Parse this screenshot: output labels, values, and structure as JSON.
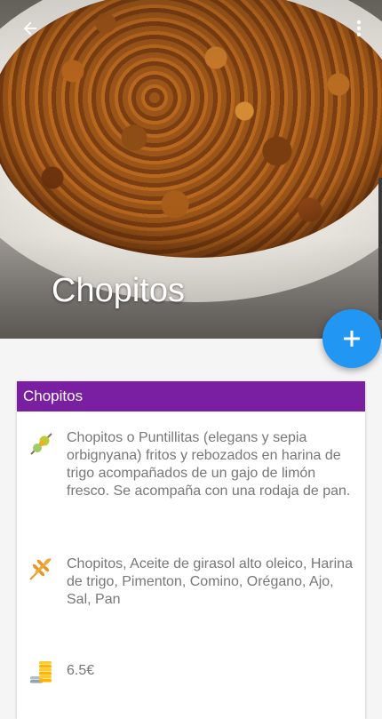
{
  "hero": {
    "title": "Chopitos"
  },
  "toolbar": {
    "back_icon": "arrow-back-icon",
    "menu_icon": "more-vert-icon"
  },
  "fab": {
    "icon": "plus-icon",
    "color": "#2196f3"
  },
  "card": {
    "header_color": "#7b1fa2",
    "title": "Chopitos",
    "description": {
      "icon": "skewer-icon",
      "text": "Chopitos o Puntillitas (elegans y sepia orbignyana) fritos y rebozados en harina de trigo acompañados de un gajo de limón fresco. Se acompaña con una rodaja de pan."
    },
    "ingredients": {
      "icon": "wheat-icon",
      "text": "Chopitos, Aceite de girasol alto oleico, Harina de trigo, Pimenton, Comino, Orégano, Ajo, Sal, Pan"
    },
    "price": {
      "icon": "coins-icon",
      "text": "6.5€"
    }
  }
}
